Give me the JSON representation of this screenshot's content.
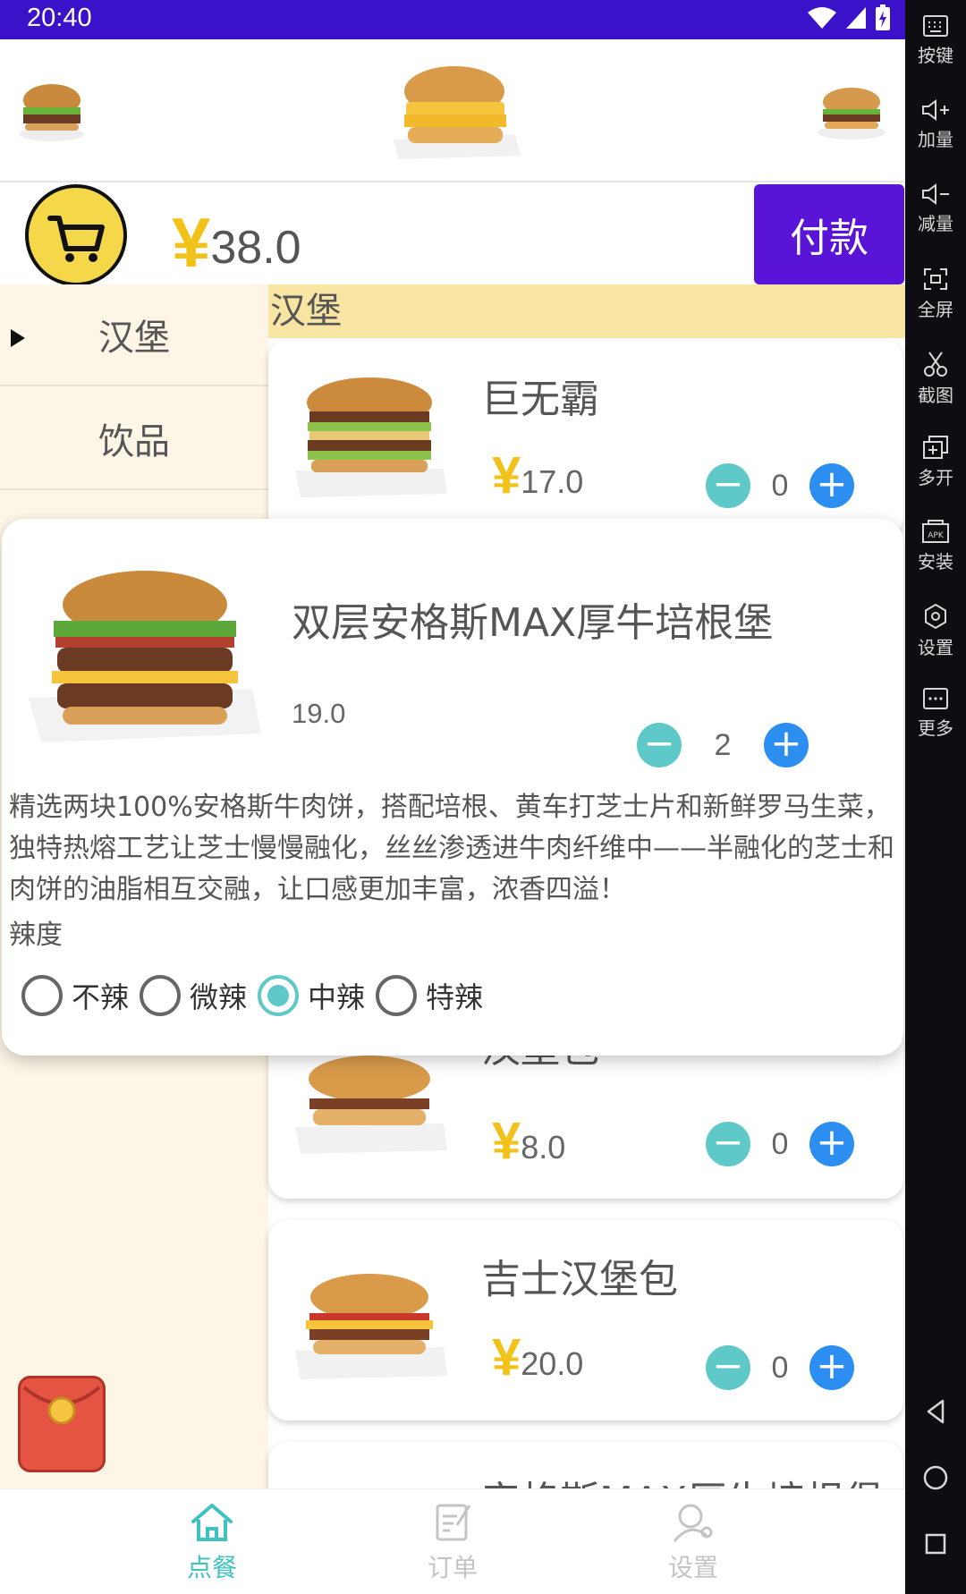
{
  "status_bar": {
    "time": "20:40"
  },
  "header": {
    "total_currency": "¥",
    "total_amount": "38.0",
    "pay_label": "付款"
  },
  "categories": [
    {
      "label": "汉堡",
      "selected": true
    },
    {
      "label": "饮品",
      "selected": false
    }
  ],
  "section_title": "汉堡",
  "products": [
    {
      "name": "巨无霸",
      "currency": "¥",
      "price": "17.0",
      "qty": "0"
    },
    {
      "name": "汉堡包",
      "currency": "¥",
      "price": "8.0",
      "qty": "0"
    },
    {
      "name": "吉士汉堡包",
      "currency": "¥",
      "price": "20.0",
      "qty": "0"
    },
    {
      "name": "安格斯MAX厚牛培根堡"
    }
  ],
  "detail": {
    "name": "双层安格斯MAX厚牛培根堡",
    "price": "19.0",
    "qty": "2",
    "description": "精选两块100%安格斯牛肉饼，搭配培根、黄车打芝士片和新鲜罗马生菜，独特热熔工艺让芝士慢慢融化，丝丝渗透进牛肉纤维中——半融化的芝士和肉饼的油脂相互交融，让口感更加丰富，浓香四溢！",
    "spicy_label": "辣度",
    "spicy_options": [
      "不辣",
      "微辣",
      "中辣",
      "特辣"
    ],
    "spicy_selected": "中辣"
  },
  "bottom_nav": [
    {
      "label": "点餐",
      "icon": "home-icon",
      "active": true
    },
    {
      "label": "订单",
      "icon": "order-icon",
      "active": false
    },
    {
      "label": "设置",
      "icon": "settings-icon",
      "active": false
    }
  ],
  "side_panel": [
    {
      "label": "按键",
      "icon": "keyboard-icon"
    },
    {
      "label": "加量",
      "icon": "volume-up-icon"
    },
    {
      "label": "减量",
      "icon": "volume-down-icon"
    },
    {
      "label": "全屏",
      "icon": "fullscreen-icon"
    },
    {
      "label": "截图",
      "icon": "screenshot-icon"
    },
    {
      "label": "多开",
      "icon": "multi-instance-icon"
    },
    {
      "label": "安装",
      "icon": "apk-install-icon"
    },
    {
      "label": "设置",
      "icon": "settings-icon"
    },
    {
      "label": "更多",
      "icon": "more-icon"
    }
  ],
  "colors": {
    "status_bar": "#3a12c9",
    "pay_button": "#5a14d8",
    "yen": "#f3c21a",
    "accent_teal": "#5fc9c9",
    "plus_blue": "#2b8ef0",
    "category_bg": "#fdf6e7",
    "section_header_bg": "#f8e5a3"
  }
}
